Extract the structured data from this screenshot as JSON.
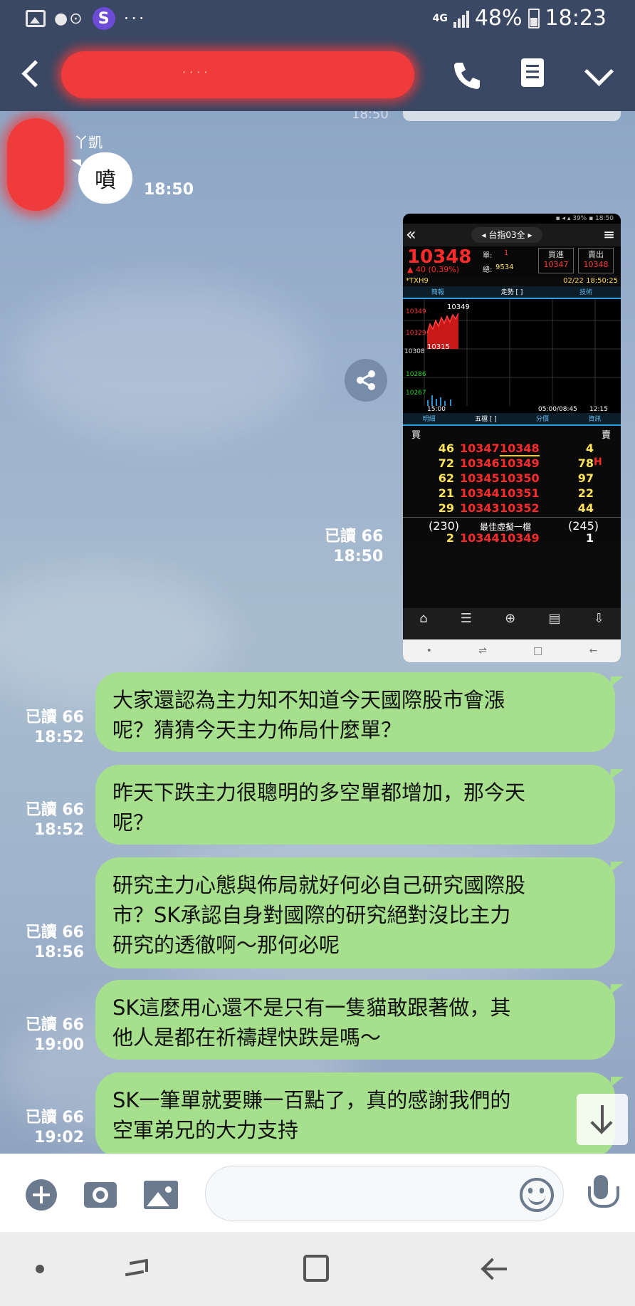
{
  "status_bar": {
    "network": "4G",
    "battery": "48%",
    "time": "18:23"
  },
  "header": {
    "chat_title_redacted": "· · · ·"
  },
  "incoming": {
    "sender": "丫凱",
    "text": "噴",
    "time": "18:50",
    "prev_time": "18:50"
  },
  "shared_image": {
    "read_label": "已讀 66",
    "time": "18:50",
    "title": "台指03全",
    "price": "10348",
    "change": "▲ 40",
    "change_pct": "(0.39%)",
    "qty_label": "單:",
    "qty_value": "1",
    "total_label": "總:",
    "total_value": "9534",
    "bid_label": "買進",
    "ask_label": "賣出",
    "bid_box": "10347",
    "ask_box": "10348",
    "symbol": "*TXH9",
    "datetime": "02/22 18:50:25",
    "tabs_top": [
      "簡報",
      "走勢 [ ]",
      "技術"
    ],
    "tabs_mid": [
      "明細",
      "五檔 [ ]",
      "分價",
      "資訊"
    ],
    "chart_high": "10349",
    "chart_low": "10315",
    "y_ticks": [
      "10349",
      "10329",
      "10308",
      "10286",
      "10267"
    ],
    "x_start": "15:00",
    "x_end": "05:00/08:45",
    "x_now": "12:15",
    "book_buy": "買",
    "book_sell": "賣",
    "book_rows": [
      {
        "bid_vol": "46",
        "bid": "10347",
        "ask": "10348",
        "ask_vol": "4",
        "flag": ""
      },
      {
        "bid_vol": "72",
        "bid": "10346",
        "ask": "10349",
        "ask_vol": "78",
        "flag": "H"
      },
      {
        "bid_vol": "62",
        "bid": "10345",
        "ask": "10350",
        "ask_vol": "97",
        "flag": ""
      },
      {
        "bid_vol": "21",
        "bid": "10344",
        "ask": "10351",
        "ask_vol": "22",
        "flag": ""
      },
      {
        "bid_vol": "29",
        "bid": "10343",
        "ask": "10352",
        "ask_vol": "44",
        "flag": ""
      }
    ],
    "book_total_bid": "(230)",
    "book_total_label": "最佳虛擬一檔",
    "book_total_ask": "(245)",
    "best_row": {
      "bid_vol": "2",
      "bid": "10344",
      "ask": "10349",
      "ask_vol": "1"
    },
    "bottom_tabs": [
      "首頁",
      "報價列表",
      "新增自選",
      "股市新聞",
      "下單"
    ]
  },
  "outgoing": [
    {
      "read": "已讀 66",
      "time": "18:52",
      "lines": [
        "大家還認為主力知不知道今天國際股市會漲",
        "呢？猜猜今天主力佈局什麼單？"
      ]
    },
    {
      "read": "已讀 66",
      "time": "18:52",
      "lines": [
        "昨天下跌主力很聰明的多空單都增加，那今天",
        "呢？"
      ]
    },
    {
      "read": "已讀 66",
      "time": "18:56",
      "lines": [
        "研究主力心態與佈局就好何必自己研究國際股",
        "市？SK承認自身對國際的研究絕對沒比主力",
        "研究的透徹啊～那何必呢"
      ]
    },
    {
      "read": "已讀 66",
      "time": "19:00",
      "lines": [
        "SK這麼用心還不是只有一隻貓敢跟著做，其",
        "他人是都在祈禱趕快跌是嗎～"
      ]
    },
    {
      "read": "已讀 66",
      "time": "19:02",
      "lines": [
        "SK一筆單就要賺一百點了，真的感謝我們的",
        "空軍弟兄的大力支持"
      ]
    }
  ],
  "input": {
    "placeholder": ""
  },
  "icons": {
    "status": [
      "gallery-icon",
      "link-icon",
      "s-app-icon",
      "more-icon",
      "signal-icon",
      "battery-icon"
    ],
    "header": [
      "back-icon",
      "phone-icon",
      "notes-icon",
      "chevron-down-icon"
    ],
    "input": [
      "plus-icon",
      "camera-icon",
      "image-icon",
      "emoji-icon",
      "mic-icon"
    ],
    "nav": [
      "dot-icon",
      "recent-apps-icon",
      "home-icon",
      "back-nav-icon"
    ]
  },
  "colors": {
    "header_bg": "#3a4863",
    "outgoing_bubble": "#a7e08c",
    "incoming_bubble": "#ffffff",
    "redaction": "#ef3b3b",
    "price_red": "#ff2b2b"
  }
}
